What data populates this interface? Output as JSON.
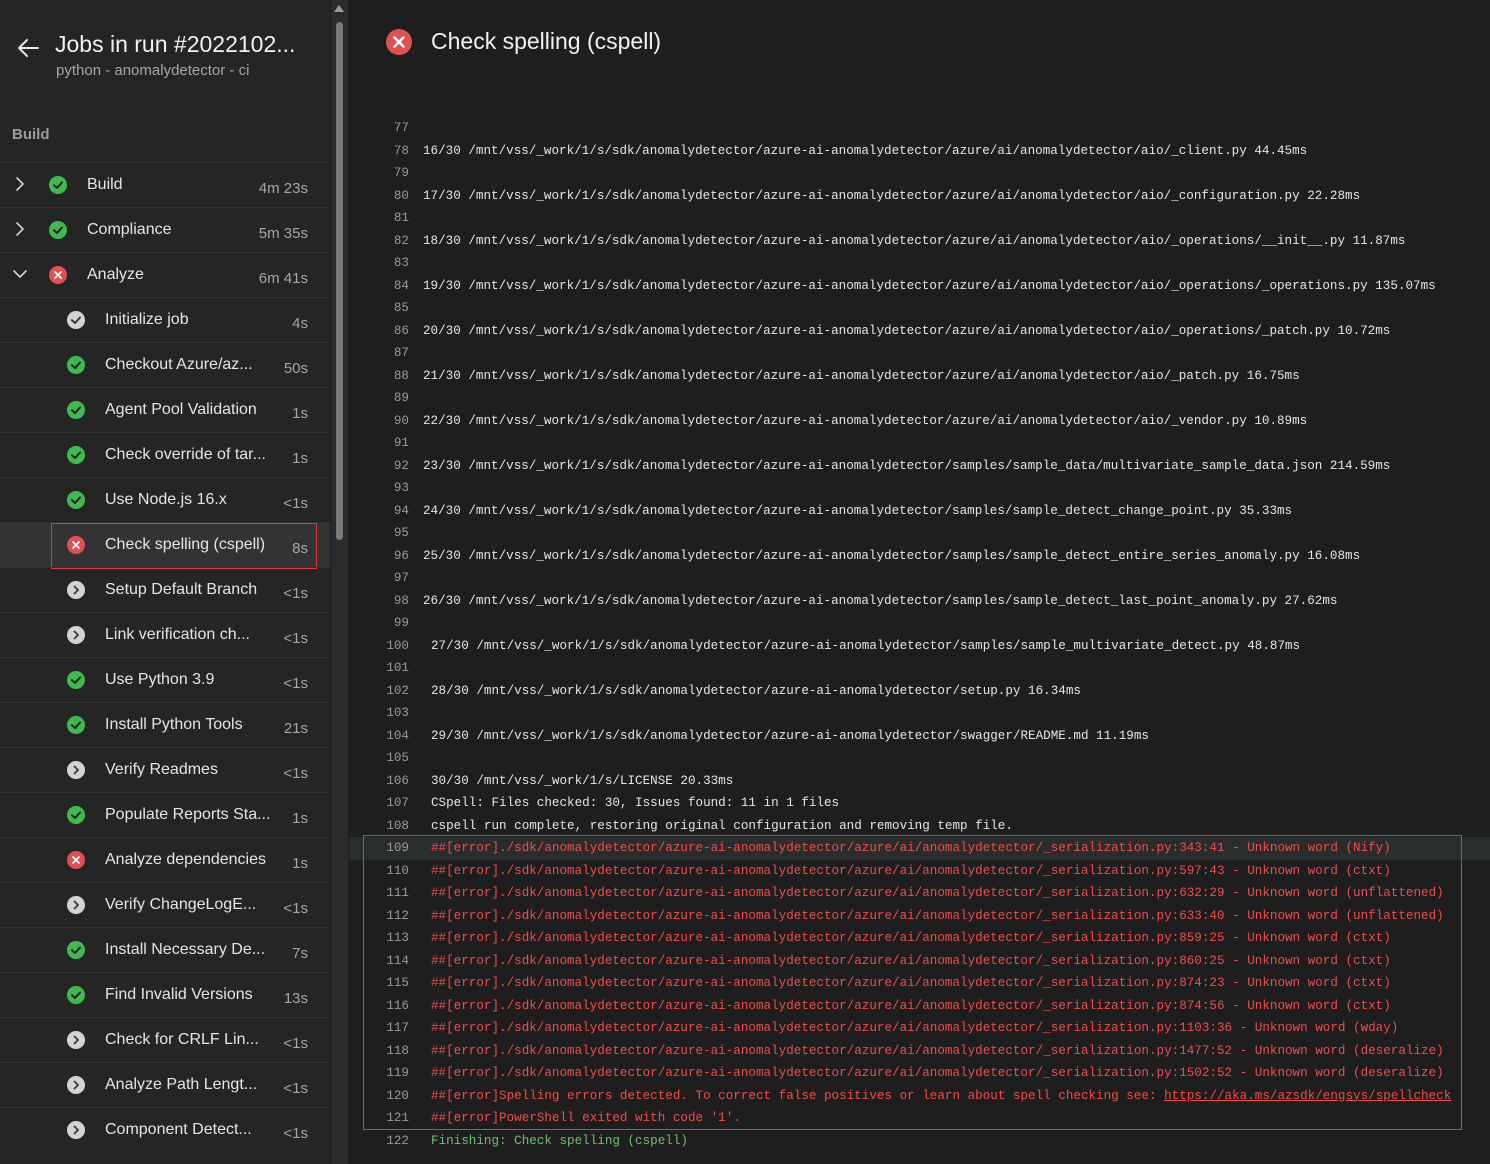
{
  "header": {
    "title": "Jobs in run #2022102...",
    "subtitle": "python - anomalydetector - ci",
    "section": "Build"
  },
  "jobs": [
    {
      "label": "Build",
      "duration": "4m 23s",
      "status": "success",
      "expanded": false
    },
    {
      "label": "Compliance",
      "duration": "5m 35s",
      "status": "success",
      "expanded": false
    },
    {
      "label": "Analyze",
      "duration": "6m 41s",
      "status": "failed",
      "expanded": true
    }
  ],
  "steps": [
    {
      "label": "Initialize job",
      "duration": "4s",
      "status": "done"
    },
    {
      "label": "Checkout Azure/az...",
      "duration": "50s",
      "status": "success"
    },
    {
      "label": "Agent Pool Validation",
      "duration": "1s",
      "status": "success"
    },
    {
      "label": "Check override of tar...",
      "duration": "1s",
      "status": "success"
    },
    {
      "label": "Use Node.js 16.x",
      "duration": "<1s",
      "status": "success"
    },
    {
      "label": "Check spelling (cspell)",
      "duration": "8s",
      "status": "failed",
      "selected": true
    },
    {
      "label": "Setup Default Branch",
      "duration": "<1s",
      "status": "skipped"
    },
    {
      "label": "Link verification ch...",
      "duration": "<1s",
      "status": "skipped"
    },
    {
      "label": "Use Python 3.9",
      "duration": "<1s",
      "status": "success"
    },
    {
      "label": "Install Python Tools",
      "duration": "21s",
      "status": "success"
    },
    {
      "label": "Verify Readmes",
      "duration": "<1s",
      "status": "skipped"
    },
    {
      "label": "Populate Reports Sta...",
      "duration": "1s",
      "status": "success"
    },
    {
      "label": "Analyze dependencies",
      "duration": "1s",
      "status": "failed"
    },
    {
      "label": "Verify ChangeLogE...",
      "duration": "<1s",
      "status": "skipped"
    },
    {
      "label": "Install Necessary De...",
      "duration": "7s",
      "status": "success"
    },
    {
      "label": "Find Invalid Versions",
      "duration": "13s",
      "status": "success"
    },
    {
      "label": "Check for CRLF Lin...",
      "duration": "<1s",
      "status": "skipped"
    },
    {
      "label": "Analyze Path Lengt...",
      "duration": "<1s",
      "status": "skipped"
    },
    {
      "label": "Component Detect...",
      "duration": "<1s",
      "status": "skipped"
    }
  ],
  "main": {
    "title": "Check spelling (cspell)",
    "status": "failed"
  },
  "log": [
    {
      "n": "77",
      "t": ""
    },
    {
      "n": "78",
      "t": "16/30 /mnt/vss/_work/1/s/sdk/anomalydetector/azure-ai-anomalydetector/azure/ai/anomalydetector/aio/_client.py 44.45ms"
    },
    {
      "n": "79",
      "t": ""
    },
    {
      "n": "80",
      "t": "17/30 /mnt/vss/_work/1/s/sdk/anomalydetector/azure-ai-anomalydetector/azure/ai/anomalydetector/aio/_configuration.py 22.28ms"
    },
    {
      "n": "81",
      "t": ""
    },
    {
      "n": "82",
      "t": "18/30 /mnt/vss/_work/1/s/sdk/anomalydetector/azure-ai-anomalydetector/azure/ai/anomalydetector/aio/_operations/__init__.py 11.87ms"
    },
    {
      "n": "83",
      "t": ""
    },
    {
      "n": "84",
      "t": "19/30 /mnt/vss/_work/1/s/sdk/anomalydetector/azure-ai-anomalydetector/azure/ai/anomalydetector/aio/_operations/_operations.py 135.07ms"
    },
    {
      "n": "85",
      "t": ""
    },
    {
      "n": "86",
      "t": "20/30 /mnt/vss/_work/1/s/sdk/anomalydetector/azure-ai-anomalydetector/azure/ai/anomalydetector/aio/_operations/_patch.py 10.72ms"
    },
    {
      "n": "87",
      "t": ""
    },
    {
      "n": "88",
      "t": "21/30 /mnt/vss/_work/1/s/sdk/anomalydetector/azure-ai-anomalydetector/azure/ai/anomalydetector/aio/_patch.py 16.75ms"
    },
    {
      "n": "89",
      "t": ""
    },
    {
      "n": "90",
      "t": "22/30 /mnt/vss/_work/1/s/sdk/anomalydetector/azure-ai-anomalydetector/azure/ai/anomalydetector/aio/_vendor.py 10.89ms"
    },
    {
      "n": "91",
      "t": ""
    },
    {
      "n": "92",
      "t": "23/30 /mnt/vss/_work/1/s/sdk/anomalydetector/azure-ai-anomalydetector/samples/sample_data/multivariate_sample_data.json 214.59ms"
    },
    {
      "n": "93",
      "t": ""
    },
    {
      "n": "94",
      "t": "24/30 /mnt/vss/_work/1/s/sdk/anomalydetector/azure-ai-anomalydetector/samples/sample_detect_change_point.py 35.33ms"
    },
    {
      "n": "95",
      "t": ""
    },
    {
      "n": "96",
      "t": "25/30 /mnt/vss/_work/1/s/sdk/anomalydetector/azure-ai-anomalydetector/samples/sample_detect_entire_series_anomaly.py 16.08ms"
    },
    {
      "n": "97",
      "t": ""
    },
    {
      "n": "98",
      "t": "26/30 /mnt/vss/_work/1/s/sdk/anomalydetector/azure-ai-anomalydetector/samples/sample_detect_last_point_anomaly.py 27.62ms"
    },
    {
      "n": "99",
      "t": ""
    },
    {
      "n": "100",
      "t": "27/30 /mnt/vss/_work/1/s/sdk/anomalydetector/azure-ai-anomalydetector/samples/sample_multivariate_detect.py 48.87ms",
      "indent": true
    },
    {
      "n": "101",
      "t": ""
    },
    {
      "n": "102",
      "t": "28/30 /mnt/vss/_work/1/s/sdk/anomalydetector/azure-ai-anomalydetector/setup.py 16.34ms",
      "indent": true
    },
    {
      "n": "103",
      "t": ""
    },
    {
      "n": "104",
      "t": "29/30 /mnt/vss/_work/1/s/sdk/anomalydetector/azure-ai-anomalydetector/swagger/README.md 11.19ms",
      "indent": true
    },
    {
      "n": "105",
      "t": ""
    },
    {
      "n": "106",
      "t": "30/30 /mnt/vss/_work/1/s/LICENSE 20.33ms",
      "indent": true
    },
    {
      "n": "107",
      "t": "CSpell: Files checked: 30, Issues found: 11 in 1 files",
      "indent": true
    },
    {
      "n": "108",
      "t": "cspell run complete, restoring original configuration and removing temp file.",
      "indent": true
    },
    {
      "n": "109",
      "t": "##[error]./sdk/anomalydetector/azure-ai-anomalydetector/azure/ai/anomalydetector/_serialization.py:343:41 - Unknown word (Nify)",
      "indent": true,
      "kind": "err",
      "highlight": true
    },
    {
      "n": "110",
      "t": "##[error]./sdk/anomalydetector/azure-ai-anomalydetector/azure/ai/anomalydetector/_serialization.py:597:43 - Unknown word (ctxt)",
      "indent": true,
      "kind": "err"
    },
    {
      "n": "111",
      "t": "##[error]./sdk/anomalydetector/azure-ai-anomalydetector/azure/ai/anomalydetector/_serialization.py:632:29 - Unknown word (unflattened)",
      "indent": true,
      "kind": "err"
    },
    {
      "n": "112",
      "t": "##[error]./sdk/anomalydetector/azure-ai-anomalydetector/azure/ai/anomalydetector/_serialization.py:633:40 - Unknown word (unflattened)",
      "indent": true,
      "kind": "err"
    },
    {
      "n": "113",
      "t": "##[error]./sdk/anomalydetector/azure-ai-anomalydetector/azure/ai/anomalydetector/_serialization.py:859:25 - Unknown word (ctxt)",
      "indent": true,
      "kind": "err"
    },
    {
      "n": "114",
      "t": "##[error]./sdk/anomalydetector/azure-ai-anomalydetector/azure/ai/anomalydetector/_serialization.py:860:25 - Unknown word (ctxt)",
      "indent": true,
      "kind": "err"
    },
    {
      "n": "115",
      "t": "##[error]./sdk/anomalydetector/azure-ai-anomalydetector/azure/ai/anomalydetector/_serialization.py:874:23 - Unknown word (ctxt)",
      "indent": true,
      "kind": "err"
    },
    {
      "n": "116",
      "t": "##[error]./sdk/anomalydetector/azure-ai-anomalydetector/azure/ai/anomalydetector/_serialization.py:874:56 - Unknown word (ctxt)",
      "indent": true,
      "kind": "err"
    },
    {
      "n": "117",
      "t": "##[error]./sdk/anomalydetector/azure-ai-anomalydetector/azure/ai/anomalydetector/_serialization.py:1103:36 - Unknown word (wday)",
      "indent": true,
      "kind": "err"
    },
    {
      "n": "118",
      "t": "##[error]./sdk/anomalydetector/azure-ai-anomalydetector/azure/ai/anomalydetector/_serialization.py:1477:52 - Unknown word (deseralize)",
      "indent": true,
      "kind": "err"
    },
    {
      "n": "119",
      "t": "##[error]./sdk/anomalydetector/azure-ai-anomalydetector/azure/ai/anomalydetector/_serialization.py:1502:52 - Unknown word (deseralize)",
      "indent": true,
      "kind": "err"
    },
    {
      "n": "120",
      "t": "##[error]Spelling errors detected. To correct false positives or learn about spell checking see: ",
      "link": "https://aka.ms/azsdk/engsys/spellcheck",
      "indent": true,
      "kind": "err"
    },
    {
      "n": "121",
      "t": "##[error]PowerShell exited with code '1'.",
      "indent": true,
      "kind": "err"
    },
    {
      "n": "122",
      "t": "Finishing: Check spelling (cspell)",
      "indent": true,
      "kind": "ok"
    }
  ],
  "colors": {
    "success": "#3fb950",
    "failed": "#e05252",
    "skipped": "#d4d4d4",
    "error_text": "#f14c4c",
    "ok_text": "#6cc36c",
    "highlight_border": "#e03c3c"
  }
}
